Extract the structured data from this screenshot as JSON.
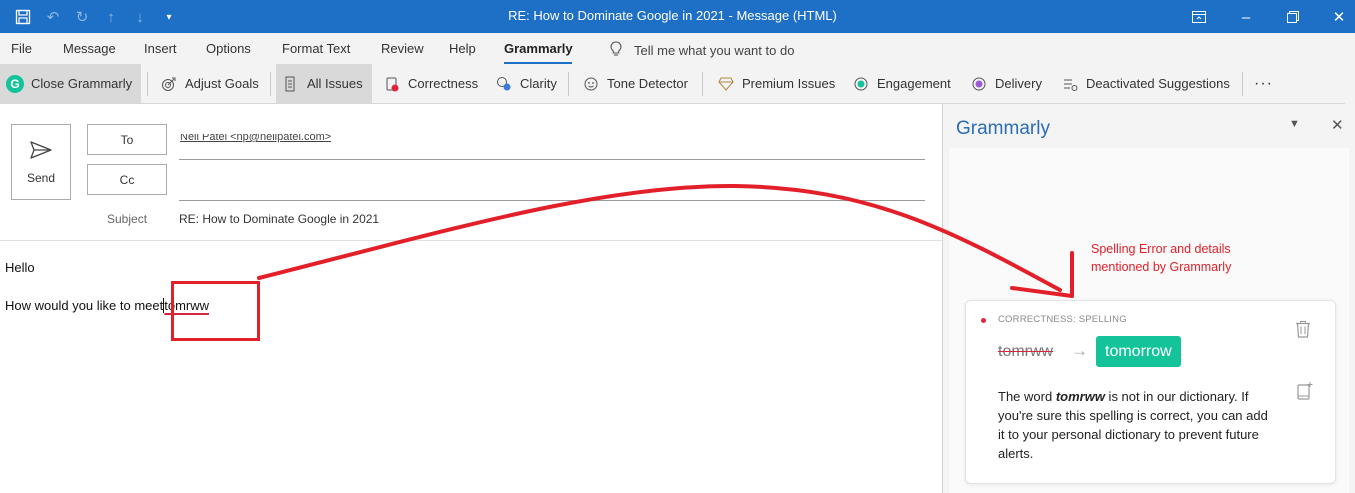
{
  "window": {
    "title": "RE: How to Dominate Google in 2021  -  Message (HTML)"
  },
  "quick_access": {
    "icons": [
      "save-icon",
      "undo-icon",
      "redo-icon",
      "up-arrow-icon",
      "down-arrow-icon",
      "customize-icon"
    ]
  },
  "window_controls": {
    "icons": [
      "ribbon-display-icon",
      "minimize-icon",
      "restore-icon",
      "close-icon"
    ]
  },
  "ribbon_tabs": {
    "file": "File",
    "message": "Message",
    "insert": "Insert",
    "options": "Options",
    "format_text": "Format Text",
    "review": "Review",
    "help": "Help",
    "grammarly": "Grammarly",
    "active": "Grammarly",
    "tell_me": "Tell me what you want to do"
  },
  "grammarly_toolbar": {
    "close_grammarly": "Close Grammarly",
    "adjust_goals": "Adjust Goals",
    "all_issues": "All Issues",
    "correctness": "Correctness",
    "clarity": "Clarity",
    "tone_detector": "Tone Detector",
    "premium_issues": "Premium Issues",
    "engagement": "Engagement",
    "delivery": "Delivery",
    "deactivated_suggestions": "Deactivated Suggestions",
    "more": "···"
  },
  "compose": {
    "send_label": "Send",
    "to_label": "To",
    "cc_label": "Cc",
    "to_value": "Neil Patel <np@neilpatel.com>",
    "cc_value": "",
    "subject_label": "Subject",
    "subject_value": "RE: How to Dominate Google in 2021",
    "body_greeting": "Hello",
    "body_text": "How would you like to meet",
    "body_misspelled": "tomrww"
  },
  "annotation": {
    "text": "Spelling Error and details mentioned by Grammarly"
  },
  "grammarly_pane": {
    "title": "Grammarly",
    "card": {
      "category": "CORRECTNESS: SPELLING",
      "original": "tomrww",
      "suggestion": "tomorrow",
      "desc_pre": "The word ",
      "desc_word": "tomrww",
      "desc_post": " is not in our dictionary. If you're sure this spelling is correct, you can add it to your personal dictionary to prevent future alerts."
    }
  },
  "colors": {
    "title_bar": "#1e6fc6",
    "grammarly_green": "#15c39a",
    "error_red": "#d9263f",
    "annotation_red": "#e3202a",
    "pane_title_blue": "#2b6cb8"
  }
}
